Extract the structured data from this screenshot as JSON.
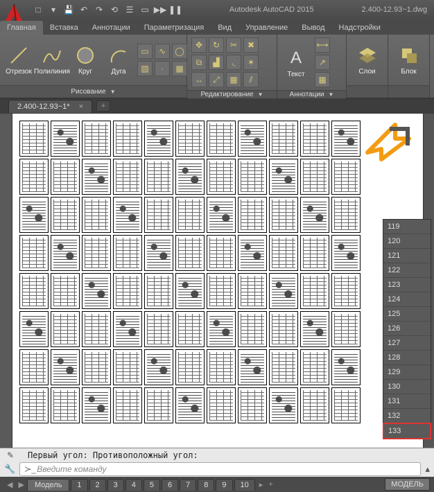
{
  "titlebar": {
    "app_name": "Autodesk AutoCAD 2015",
    "filename": "2.400-12.93~1.dwg",
    "qat": {
      "new": "□",
      "dd": "▾",
      "save": "💾",
      "undo": "↶",
      "redo": "↷",
      "link": "⟲",
      "props": "☰",
      "rect": "▭",
      "run": "▶▶",
      "pause": "❚❚"
    }
  },
  "ribbon_tabs": {
    "items": [
      "Главная",
      "Вставка",
      "Аннотации",
      "Параметризация",
      "Вид",
      "Управление",
      "Вывод",
      "Надстройки"
    ],
    "active": 0
  },
  "ribbon": {
    "draw": {
      "label": "Рисование",
      "line": "Отрезок",
      "polyline": "Полилиния",
      "circle": "Круг",
      "arc": "Дуга"
    },
    "modify": {
      "label": "Редактирование"
    },
    "annot": {
      "label": "Аннотации",
      "text": "Текст"
    },
    "layers": {
      "label": "Слои"
    },
    "block": {
      "label": "Блок"
    }
  },
  "file_tab": {
    "name": "2.400-12.93~1*"
  },
  "layout_list": [
    "119",
    "120",
    "121",
    "122",
    "123",
    "124",
    "125",
    "126",
    "127",
    "128",
    "129",
    "130",
    "131",
    "132",
    "133"
  ],
  "layout_highlight": "133",
  "command": {
    "history": "Первый угол: Противоположный угол:",
    "placeholder": "Введите команду"
  },
  "bottom": {
    "model": "Модель",
    "tabs": [
      "1",
      "2",
      "3",
      "4",
      "5",
      "6",
      "7",
      "8",
      "9",
      "10"
    ],
    "model_btn": "МОДЕЛЬ"
  },
  "icons": {
    "line_svg": "/",
    "poly_svg": "∿",
    "circle_svg": "◯",
    "arc_svg": "◟"
  }
}
